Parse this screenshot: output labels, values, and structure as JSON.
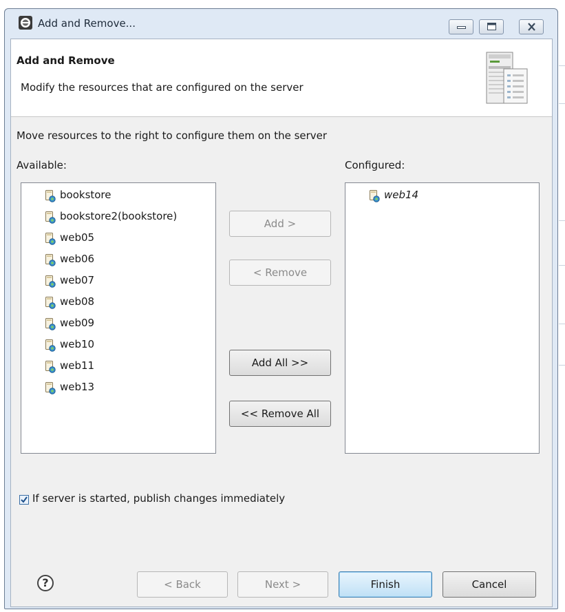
{
  "window": {
    "title": "Add and Remove...",
    "controls": [
      "minimize-icon",
      "maximize-icon",
      "close-icon"
    ]
  },
  "header": {
    "title": "Add and Remove",
    "description": "Modify the resources that are configured on the server",
    "icon": "server-wizard-icon"
  },
  "body": {
    "instruction": "Move resources to the right to configure them on the server",
    "available_label": "Available:",
    "configured_label": "Configured:"
  },
  "available": [
    {
      "label": "bookstore"
    },
    {
      "label": "bookstore2(bookstore)"
    },
    {
      "label": "web05"
    },
    {
      "label": "web06"
    },
    {
      "label": "web07"
    },
    {
      "label": "web08"
    },
    {
      "label": "web09"
    },
    {
      "label": "web10"
    },
    {
      "label": "web11"
    },
    {
      "label": "web13"
    }
  ],
  "configured": [
    {
      "label": "web14"
    }
  ],
  "buttons": {
    "add": "Add >",
    "remove": "< Remove",
    "add_all": "Add All >>",
    "remove_all": "<< Remove All"
  },
  "publish_option": {
    "label": "If server is started, publish changes immediately",
    "checked": true
  },
  "footer": {
    "help": "?",
    "back": "< Back",
    "next": "Next >",
    "finish": "Finish",
    "cancel": "Cancel"
  },
  "colors": {
    "window_frame": "#dfe9f5",
    "primary_button": "#bfe0f6",
    "list_border": "#828790"
  }
}
